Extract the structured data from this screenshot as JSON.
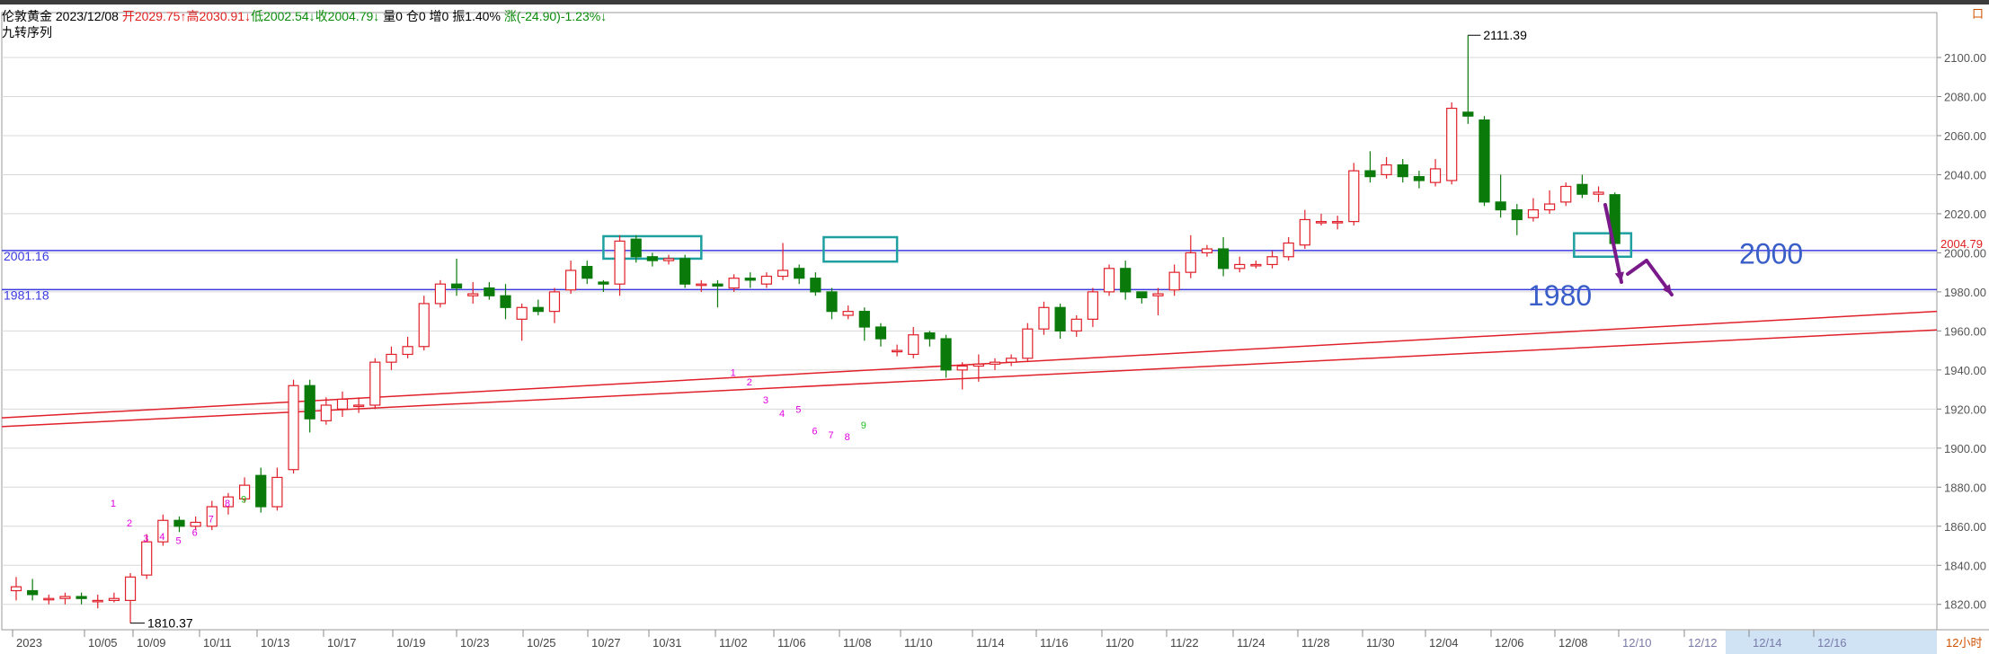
{
  "header": {
    "symbol": "伦敦黄金",
    "date": "2023/12/08",
    "open": "开2029.75↑",
    "high": "高2030.91↓",
    "low": "低2002.54↓",
    "close": "收2004.79↓",
    "volume": "量0",
    "position": "仓0",
    "increase": "增0",
    "amplitude": "振1.40%",
    "change": "涨(-24.90)-1.23%↓",
    "indicator": "九转序列"
  },
  "corner_mark": "口",
  "timeframe": "12小时",
  "colors": {
    "up": "#e0202a",
    "down": "#0a7a0a",
    "hline": "#3a3ae0",
    "box": "#1ea0a0",
    "arrow": "#7a1a8a",
    "trend": "#e0202a",
    "td_buy": "#e000e0",
    "td_nine": "#20c020",
    "grid": "#d8d8d8"
  },
  "chart_data": {
    "type": "candlestick",
    "ylim": [
      1807,
      2123
    ],
    "y_ticks": [
      "1820.00",
      "1840.00",
      "1860.00",
      "1880.00",
      "1900.00",
      "1920.00",
      "1940.00",
      "1960.00",
      "1980.00",
      "2000.00",
      "2020.00",
      "2040.00",
      "2060.00",
      "2080.00",
      "2100.00"
    ],
    "x_labels": [
      "2023",
      "10/05",
      "10/09",
      "10/11",
      "10/13",
      "10/17",
      "10/19",
      "10/23",
      "10/25",
      "10/27",
      "10/31",
      "11/02",
      "11/06",
      "11/08",
      "11/10",
      "11/14",
      "11/16",
      "11/20",
      "11/22",
      "11/24",
      "11/28",
      "11/30",
      "12/04",
      "12/06",
      "12/08",
      "12/10",
      "12/12",
      "12/14",
      "12/16"
    ],
    "candles": [
      [
        1827,
        1829,
        1822,
        1834
      ],
      [
        1827,
        1825,
        1822,
        1833
      ],
      [
        1823,
        1823,
        1820,
        1825
      ],
      [
        1823,
        1824,
        1820,
        1826
      ],
      [
        1824,
        1823,
        1820,
        1826
      ],
      [
        1822,
        1822,
        1818,
        1825
      ],
      [
        1822,
        1823,
        1821,
        1826
      ],
      [
        1822,
        1834,
        1810.37,
        1836
      ],
      [
        1835,
        1852,
        1833,
        1856
      ],
      [
        1852,
        1863,
        1850,
        1866
      ],
      [
        1863,
        1860,
        1857,
        1865
      ],
      [
        1860,
        1862,
        1858,
        1865
      ],
      [
        1860,
        1870,
        1858,
        1873
      ],
      [
        1870,
        1875,
        1866,
        1877
      ],
      [
        1874,
        1881,
        1872,
        1885
      ],
      [
        1886,
        1870,
        1867,
        1890
      ],
      [
        1870,
        1885,
        1868,
        1890
      ],
      [
        1889,
        1932,
        1887,
        1935
      ],
      [
        1932,
        1915,
        1908,
        1935
      ],
      [
        1914,
        1922,
        1912,
        1926
      ],
      [
        1920,
        1925,
        1916,
        1929
      ],
      [
        1922,
        1922,
        1918,
        1926
      ],
      [
        1922,
        1944,
        1920,
        1946
      ],
      [
        1944,
        1948,
        1940,
        1952
      ],
      [
        1948,
        1952,
        1946,
        1957
      ],
      [
        1952,
        1974,
        1950,
        1978
      ],
      [
        1974,
        1984,
        1972,
        1986
      ],
      [
        1984,
        1982,
        1978,
        1997
      ],
      [
        1978,
        1979,
        1974,
        1985
      ],
      [
        1982,
        1978,
        1976,
        1985
      ],
      [
        1978,
        1972,
        1966,
        1984
      ],
      [
        1966,
        1972,
        1955,
        1974
      ],
      [
        1972,
        1970,
        1968,
        1976
      ],
      [
        1970,
        1980,
        1964,
        1982
      ],
      [
        1981,
        1991,
        1979,
        1996
      ],
      [
        1993,
        1987,
        1984,
        1996
      ],
      [
        1985,
        1984,
        1980,
        1986
      ],
      [
        1984,
        2006,
        1978,
        2009
      ],
      [
        2007,
        1998,
        1995,
        2009
      ],
      [
        1998,
        1996,
        1993,
        2000
      ],
      [
        1996,
        1997,
        1994,
        1999
      ],
      [
        1997,
        1984,
        1982,
        1999
      ],
      [
        1984,
        1984,
        1980,
        1986
      ],
      [
        1984,
        1983,
        1972,
        1986
      ],
      [
        1982,
        1987,
        1980,
        1989
      ],
      [
        1987,
        1986,
        1982,
        1990
      ],
      [
        1984,
        1988,
        1982,
        1990
      ],
      [
        1988,
        1991,
        1986,
        2005
      ],
      [
        1992,
        1987,
        1984,
        1994
      ],
      [
        1987,
        1980,
        1978,
        1990
      ],
      [
        1980,
        1970,
        1966,
        1982
      ],
      [
        1968,
        1970,
        1966,
        1973
      ],
      [
        1970,
        1962,
        1955,
        1972
      ],
      [
        1962,
        1956,
        1952,
        1964
      ],
      [
        1950,
        1950,
        1947,
        1953
      ],
      [
        1948,
        1958,
        1946,
        1962
      ],
      [
        1959,
        1956,
        1952,
        1960
      ],
      [
        1956,
        1940,
        1936,
        1958
      ],
      [
        1940,
        1942,
        1930,
        1944
      ],
      [
        1942,
        1943,
        1934,
        1948
      ],
      [
        1943,
        1944,
        1940,
        1946
      ],
      [
        1944,
        1946,
        1942,
        1948
      ],
      [
        1946,
        1961,
        1944,
        1964
      ],
      [
        1961,
        1972,
        1958,
        1975
      ],
      [
        1972,
        1960,
        1956,
        1974
      ],
      [
        1960,
        1966,
        1957,
        1968
      ],
      [
        1966,
        1980,
        1962,
        1982
      ],
      [
        1980,
        1992,
        1978,
        1994
      ],
      [
        1992,
        1980,
        1976,
        1996
      ],
      [
        1980,
        1977,
        1974,
        1980
      ],
      [
        1978,
        1979,
        1968,
        1982
      ],
      [
        1981,
        1990,
        1978,
        1994
      ],
      [
        1990,
        2000,
        1987,
        2009
      ],
      [
        2000,
        2002,
        1998,
        2004
      ],
      [
        2002,
        1992,
        1988,
        2008
      ],
      [
        1992,
        1994,
        1990,
        1998
      ],
      [
        1994,
        1994,
        1992,
        1996
      ],
      [
        1994,
        1998,
        1992,
        2001
      ],
      [
        1998,
        2005,
        1996,
        2008
      ],
      [
        2004,
        2017,
        2002,
        2022
      ],
      [
        2016,
        2016,
        2014,
        2020
      ],
      [
        2016,
        2016,
        2012,
        2019
      ],
      [
        2016,
        2042,
        2014,
        2046
      ],
      [
        2042,
        2039,
        2036,
        2052
      ],
      [
        2040,
        2045,
        2038,
        2049
      ],
      [
        2045,
        2039,
        2036,
        2048
      ],
      [
        2039,
        2037,
        2033,
        2042
      ],
      [
        2036,
        2043,
        2034,
        2048
      ],
      [
        2037,
        2074,
        2035,
        2077
      ],
      [
        2072,
        2070,
        2066,
        2111.39
      ],
      [
        2068,
        2026,
        2024,
        2070
      ],
      [
        2026,
        2022,
        2018,
        2040
      ],
      [
        2022,
        2017,
        2009,
        2025
      ],
      [
        2018,
        2022,
        2016,
        2028
      ],
      [
        2022,
        2025,
        2020,
        2032
      ],
      [
        2026,
        2034,
        2024,
        2036
      ],
      [
        2035,
        2030,
        2028,
        2040
      ],
      [
        2030,
        2031,
        2026,
        2034
      ],
      [
        2029.75,
        2004.79,
        2002.54,
        2030.91
      ]
    ],
    "price_labels": [
      "2111.39",
      "1810.37"
    ],
    "current_price": "2004.79",
    "hlines": [
      {
        "value": 2001.16,
        "label": "2001.16"
      },
      {
        "value": 1981.18,
        "label": "1981.18"
      }
    ],
    "annotations": [
      "2000",
      "1980"
    ],
    "td_sequence": [
      "1",
      "2",
      "3",
      "4",
      "5",
      "6",
      "7",
      "8",
      "9",
      "1",
      "2",
      "3",
      "4",
      "5",
      "6",
      "7",
      "8",
      "9"
    ]
  }
}
